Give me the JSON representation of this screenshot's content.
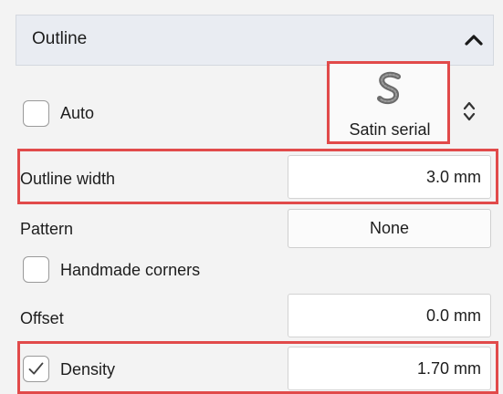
{
  "panel": {
    "section_title": "Outline",
    "auto_label": "Auto",
    "auto_checked": false,
    "stitch_type": {
      "label": "Satin serial",
      "icon": "satin-stitch-icon"
    },
    "outline_width": {
      "label": "Outline width",
      "value": "3.0 mm"
    },
    "pattern": {
      "label": "Pattern",
      "value": "None"
    },
    "handmade_corners": {
      "label": "Handmade corners",
      "checked": false
    },
    "offset": {
      "label": "Offset",
      "value": "0.0 mm"
    },
    "density": {
      "label": "Density",
      "checked": true,
      "value": "1.70 mm"
    }
  },
  "colors": {
    "highlight": "#e14a4a",
    "header_bg": "#e9ecf2",
    "panel_bg": "#f3f3f3"
  },
  "icons": [
    "chevron-up-icon",
    "satin-stitch-icon",
    "spin-arrows-icon",
    "checkmark-icon"
  ]
}
